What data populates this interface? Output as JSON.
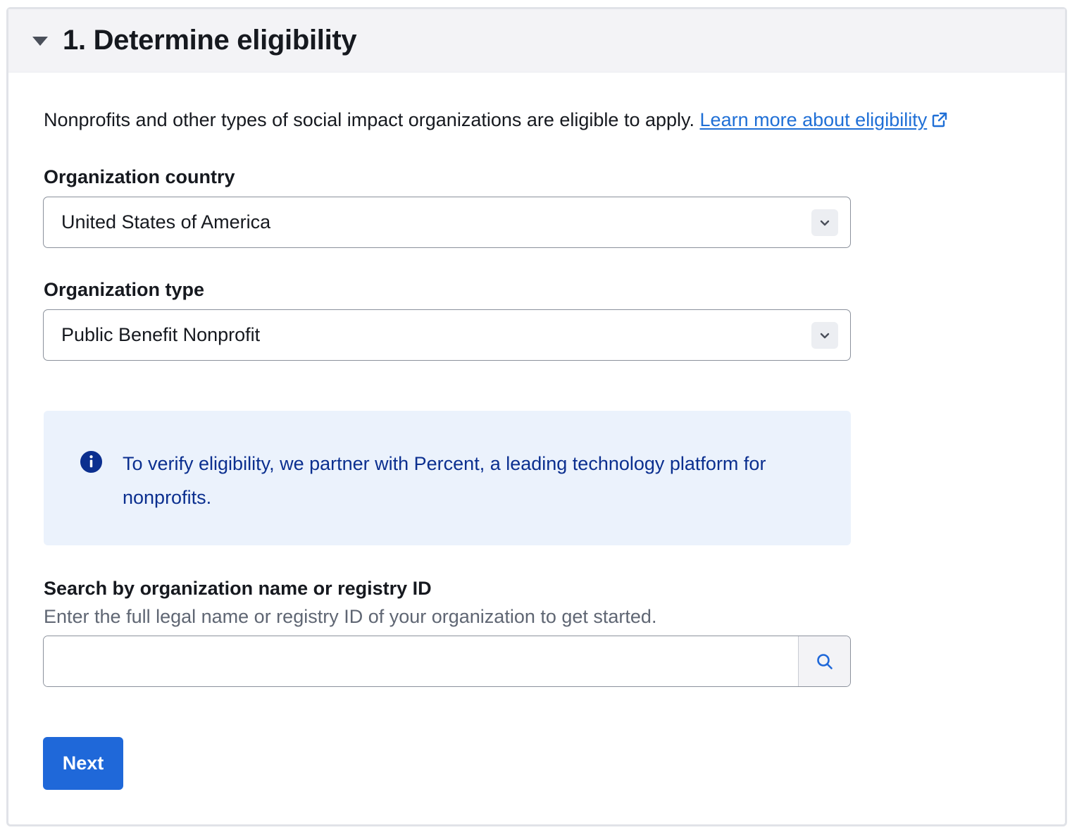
{
  "section": {
    "title": "1. Determine eligibility"
  },
  "intro": {
    "text": "Nonprofits and other types of social impact organizations are eligible to apply.",
    "link_label": "Learn more about eligibility"
  },
  "country": {
    "label": "Organization country",
    "value": "United States of America"
  },
  "org_type": {
    "label": "Organization type",
    "value": "Public Benefit Nonprofit"
  },
  "info": {
    "text": "To verify eligibility, we partner with Percent, a leading technology platform for nonprofits."
  },
  "search": {
    "label": "Search by organization name or registry ID",
    "help": "Enter the full legal name or registry ID of your organization to get started.",
    "value": "",
    "placeholder": ""
  },
  "actions": {
    "next_label": "Next"
  },
  "icons": {
    "caret": "caret-down-icon",
    "external": "external-link-icon",
    "chevron": "chevron-down-icon",
    "info": "info-icon",
    "search": "search-icon"
  },
  "colors": {
    "link": "#1f6fd6",
    "primary_button": "#1f68d9",
    "info_bg": "#ebf2fc",
    "info_text": "#0b2f8f",
    "header_bg": "#f3f3f6"
  }
}
